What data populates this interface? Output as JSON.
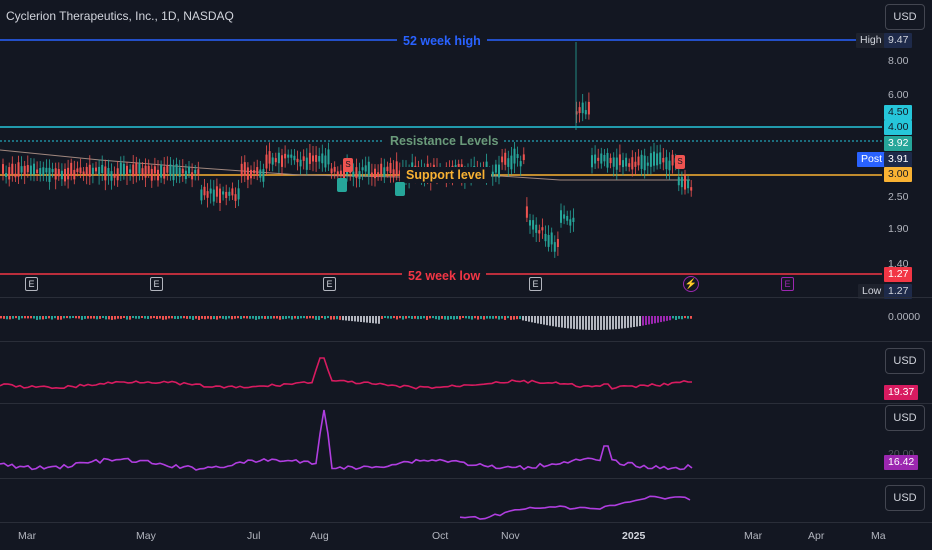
{
  "header": {
    "title": "Cyclerion Therapeutics, Inc., 1D, NASDAQ",
    "currency": "USD"
  },
  "price_axis": {
    "ticks": [
      "8.00",
      "6.00",
      "2.50",
      "1.90",
      "1.40"
    ],
    "labels": {
      "high_tag": "High",
      "high_value": "9.47",
      "resistance_top": "4.50",
      "resistance_line": "4.00",
      "close_green": "3.92",
      "post_tag": "Post",
      "post_value": "3.91",
      "support_value": "3.00",
      "low_line_value": "1.27",
      "low_tag": "Low",
      "low_value": "1.27"
    }
  },
  "annotations": {
    "week_high": "52 week high",
    "resistance": "Resistance Levels",
    "support": "Support level",
    "week_low": "52 week low"
  },
  "markers": {
    "earnings": "E",
    "split": "S"
  },
  "panes": {
    "oscillator_value": "0.0000",
    "pane2_currency": "USD",
    "pane2_value": "19.37",
    "pane3_currency": "USD",
    "pane3_tick": "20.00",
    "pane3_value": "16.42",
    "pane4_currency": "USD"
  },
  "time_axis": [
    "Mar",
    "May",
    "Jul",
    "Aug",
    "Oct",
    "Nov",
    "2025",
    "Mar",
    "Apr",
    "Ma"
  ],
  "colors": {
    "week_high": "#2962ff",
    "resistance": "#26c6da",
    "resistance_text": "#6a9a7a",
    "support": "#f9b233",
    "week_low": "#f23645",
    "pane2_line": "#d81b60",
    "pane3_line": "#b03ee0",
    "up": "#26a69a",
    "down": "#ef5350"
  }
}
